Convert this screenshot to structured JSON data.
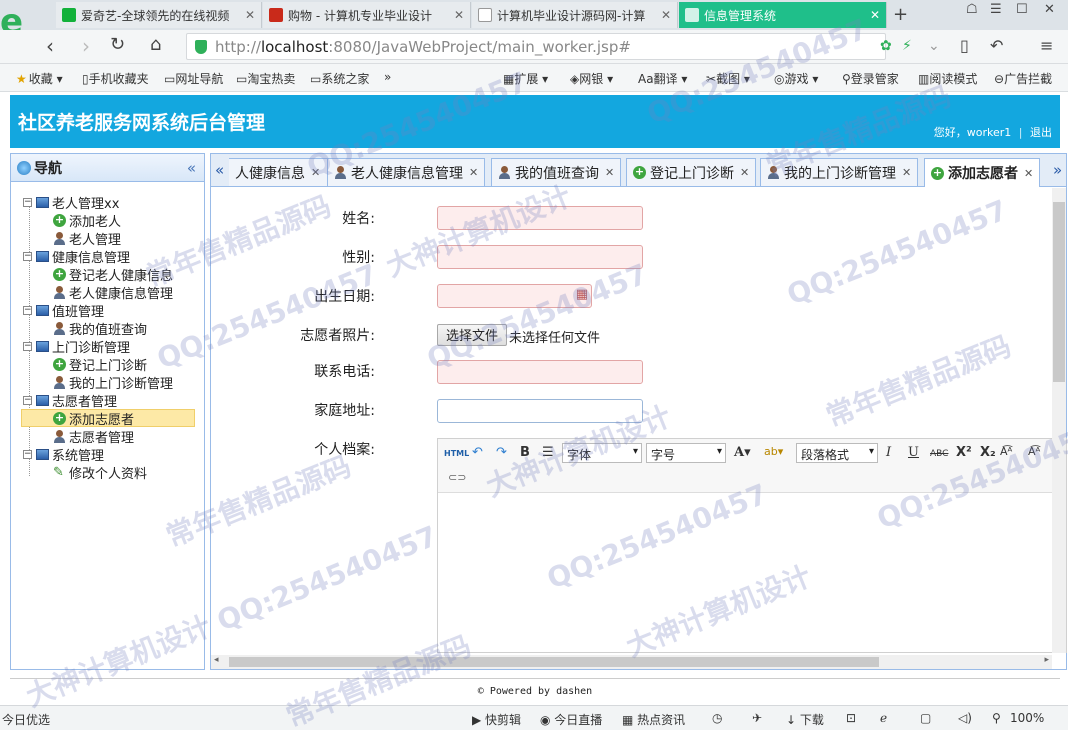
{
  "browser": {
    "tabs": [
      {
        "label": "爱奇艺-全球领先的在线视频",
        "color": "#12b13a"
      },
      {
        "label": "购物 - 计算机专业毕业设计",
        "color": "#c92a1a"
      },
      {
        "label": "计算机毕业设计源码网-计算",
        "color": "#ffffff"
      },
      {
        "label": "信息管理系统",
        "color": "#1fbf8a"
      }
    ],
    "new_tab": "+",
    "url_prefix": "http://",
    "url_host": "localhost",
    "url_rest": ":8080/JavaWebProject/main_worker.jsp#",
    "bookmarks": [
      "收藏",
      "手机收藏夹",
      "网址导航",
      "淘宝热卖",
      "系统之家"
    ],
    "toolbar_items": [
      "扩展",
      "网银",
      "翻译",
      "截图",
      "游戏",
      "登录管家",
      "阅读模式",
      "广告拦截"
    ]
  },
  "header": {
    "title": "社区养老服务网系统后台管理",
    "greeting": "您好，worker1",
    "logout": "退出"
  },
  "nav": {
    "title": "导航",
    "groups": [
      {
        "label": "老人管理xx",
        "items": [
          {
            "label": "添加老人",
            "icon": "plus"
          },
          {
            "label": "老人管理",
            "icon": "person"
          }
        ]
      },
      {
        "label": "健康信息管理",
        "items": [
          {
            "label": "登记老人健康信息",
            "icon": "plus"
          },
          {
            "label": "老人健康信息管理",
            "icon": "person"
          }
        ]
      },
      {
        "label": "值班管理",
        "items": [
          {
            "label": "我的值班查询",
            "icon": "person"
          }
        ]
      },
      {
        "label": "上门诊断管理",
        "items": [
          {
            "label": "登记上门诊断",
            "icon": "plus"
          },
          {
            "label": "我的上门诊断管理",
            "icon": "person"
          }
        ]
      },
      {
        "label": "志愿者管理",
        "items": [
          {
            "label": "添加志愿者",
            "icon": "plus"
          },
          {
            "label": "志愿者管理",
            "icon": "person"
          }
        ]
      },
      {
        "label": "系统管理",
        "items": [
          {
            "label": "修改个人资料",
            "icon": "pencil"
          }
        ]
      }
    ]
  },
  "tabs": [
    {
      "label": "人健康信息"
    },
    {
      "label": "老人健康信息管理"
    },
    {
      "label": "我的值班查询"
    },
    {
      "label": "登记上门诊断"
    },
    {
      "label": "我的上门诊断管理"
    },
    {
      "label": "添加志愿者"
    }
  ],
  "form": {
    "name_label": "姓名:",
    "gender_label": "性别:",
    "birth_label": "出生日期:",
    "photo_label": "志愿者照片:",
    "file_button": "选择文件",
    "file_status": "未选择任何文件",
    "phone_label": "联系电话:",
    "address_label": "家庭地址:",
    "profile_label": "个人档案:"
  },
  "editor": {
    "html": "HTML",
    "font": "字体",
    "size": "字号",
    "format": "段落格式",
    "bold": "B",
    "italic": "I",
    "underline": "U",
    "strike": "ABC"
  },
  "footer": "© Powered by dashen",
  "status": {
    "left": "今日优选",
    "items": [
      "快剪辑",
      "今日直播",
      "热点资讯",
      "下载"
    ],
    "zoom": "100%"
  },
  "watermarks": [
    "QQ:254540457",
    "常年售精品源码",
    "大神计算机设计"
  ]
}
